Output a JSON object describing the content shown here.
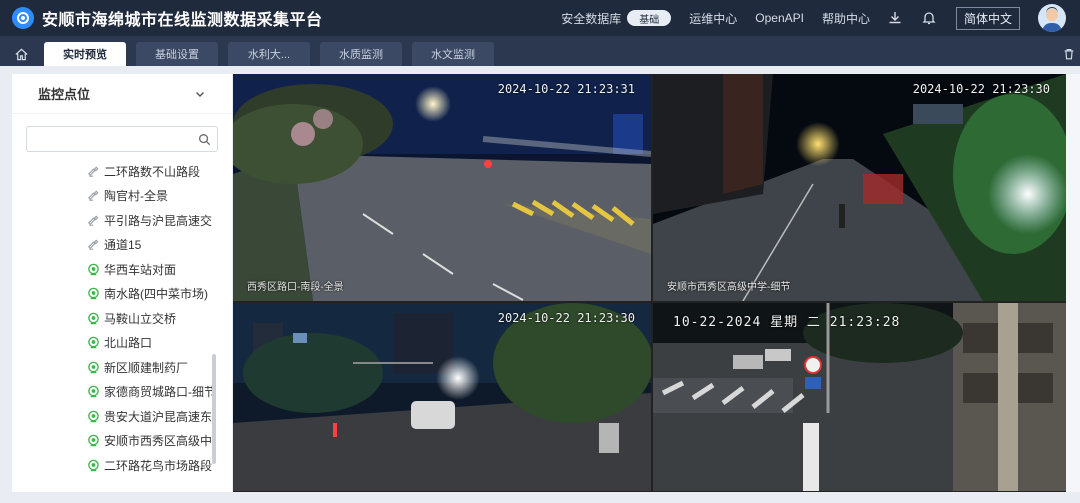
{
  "header": {
    "title": "安顺市海绵城市在线监测数据采集平台",
    "nav": [
      "安全数据库",
      "运维中心",
      "OpenAPI",
      "帮助中心"
    ],
    "toggle_label": "基础",
    "lang": "简体中文"
  },
  "tabs": [
    {
      "label": "实时预览",
      "active": true
    },
    {
      "label": "基础设置",
      "active": false
    },
    {
      "label": "水利大...",
      "active": false
    },
    {
      "label": "水质监测",
      "active": false
    },
    {
      "label": "水文监测",
      "active": false
    }
  ],
  "sidebar": {
    "title": "监控点位",
    "search_placeholder": "",
    "items": [
      {
        "label": "二环路数不山路段",
        "icon": "camera-offline"
      },
      {
        "label": "陶官村-全景",
        "icon": "camera-offline"
      },
      {
        "label": "平引路与沪昆高速交",
        "icon": "camera-offline"
      },
      {
        "label": "通道15",
        "icon": "camera-offline"
      },
      {
        "label": "华西车站对面",
        "icon": "camera-online"
      },
      {
        "label": "南水路(四中菜市场)",
        "icon": "camera-online"
      },
      {
        "label": "马鞍山立交桥",
        "icon": "camera-online"
      },
      {
        "label": "北山路口",
        "icon": "camera-online"
      },
      {
        "label": "新区顺建制药厂",
        "icon": "camera-online"
      },
      {
        "label": "家德商贸城路口-细节",
        "icon": "camera-online"
      },
      {
        "label": "贵安大道沪昆高速东",
        "icon": "camera-online"
      },
      {
        "label": "安顺市西秀区高级中",
        "icon": "camera-online"
      },
      {
        "label": "二环路花鸟市场路段",
        "icon": "camera-online"
      }
    ]
  },
  "cameras": [
    {
      "timestamp": "2024-10-22 21:23:31",
      "label": "西秀区路口-南段-全景"
    },
    {
      "timestamp": "2024-10-22 21:23:30",
      "label": "安顺市西秀区高级中学-细节"
    },
    {
      "timestamp": "2024-10-22 21:23:30",
      "label": ""
    },
    {
      "timestamp": "10-22-2024 星期 二 21:23:28",
      "label": ""
    }
  ],
  "colors": {
    "topbar": "#1f2a3d",
    "tabbar": "#2b3850",
    "accent": "#2f8cff",
    "online": "#3bb54a"
  }
}
